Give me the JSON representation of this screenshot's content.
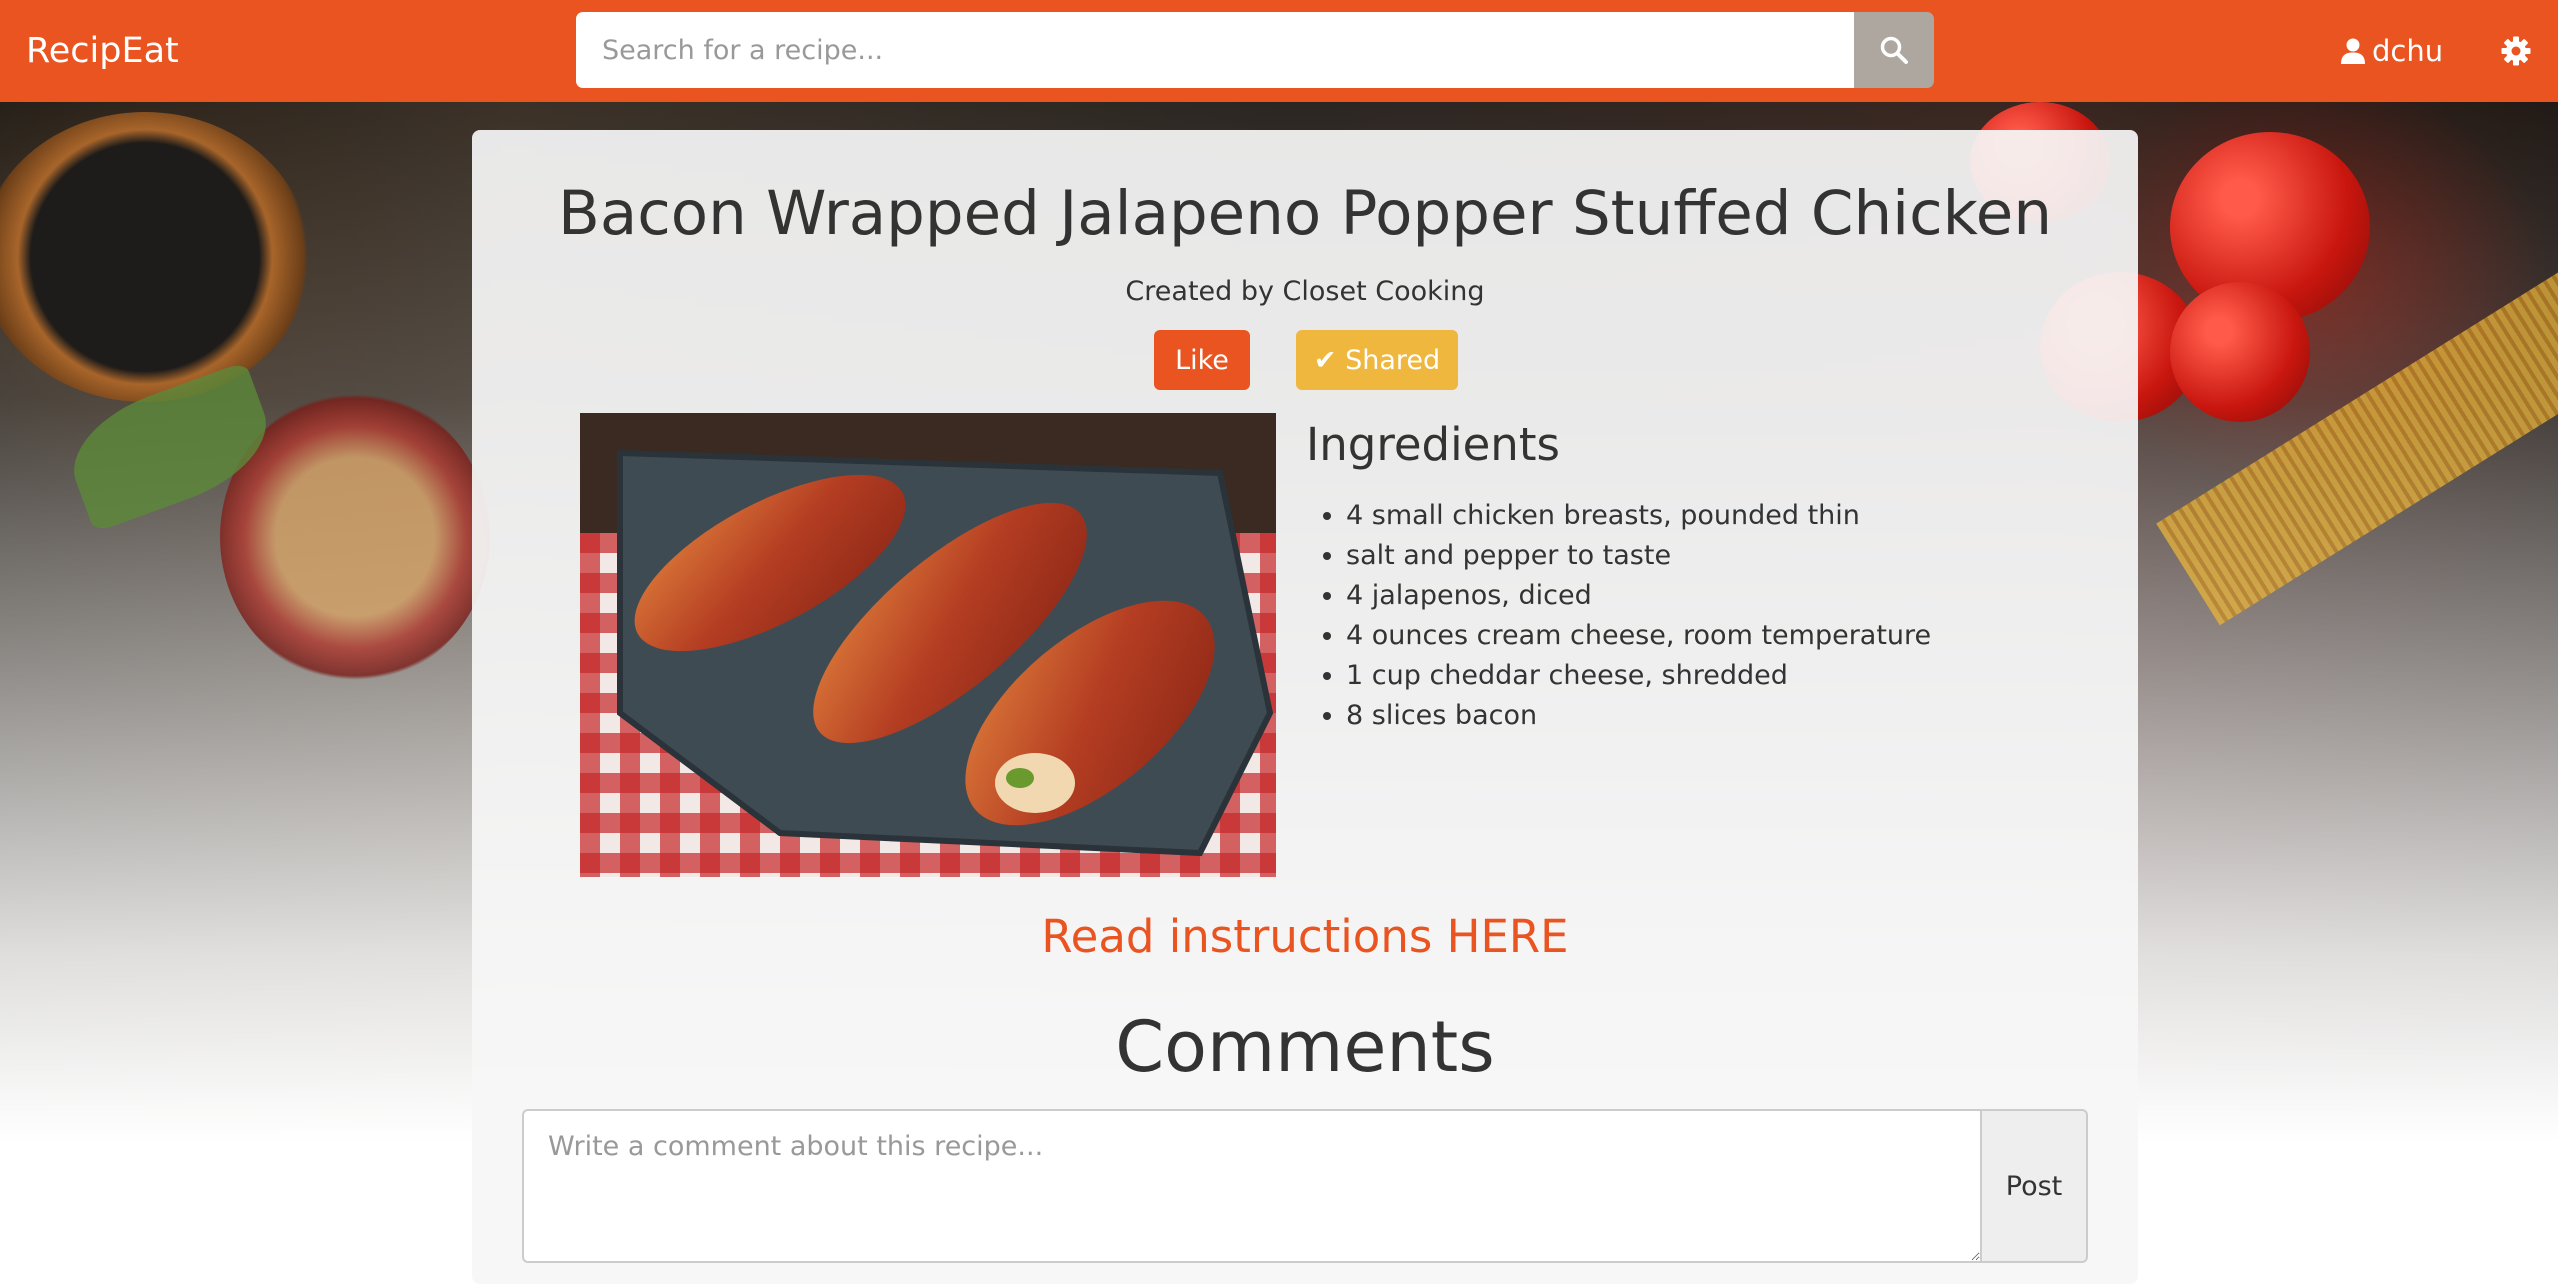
{
  "navbar": {
    "brand": "RecipEat",
    "search_placeholder": "Search for a recipe...",
    "search_icon": "search-icon",
    "username": "dchu",
    "user_icon": "user-icon",
    "settings_icon": "gear-icon"
  },
  "recipe": {
    "title": "Bacon Wrapped Jalapeno Popper Stuffed Chicken",
    "creator": "Created by Closet Cooking",
    "like_label": "Like",
    "shared_label": "✔ Shared",
    "ingredients_heading": "Ingredients",
    "ingredients": [
      "4 small chicken breasts, pounded thin",
      "salt and pepper to taste",
      "4 jalapenos, diced",
      "4 ounces cream cheese, room temperature",
      "1 cup cheddar cheese, shredded",
      "8 slices bacon"
    ],
    "instructions_link": "Read instructions HERE"
  },
  "comments": {
    "heading": "Comments",
    "placeholder": "Write a comment about this recipe...",
    "post_label": "Post"
  },
  "colors": {
    "primary": "#e95420",
    "warning": "#efb73e",
    "search_button": "#aea79f"
  }
}
